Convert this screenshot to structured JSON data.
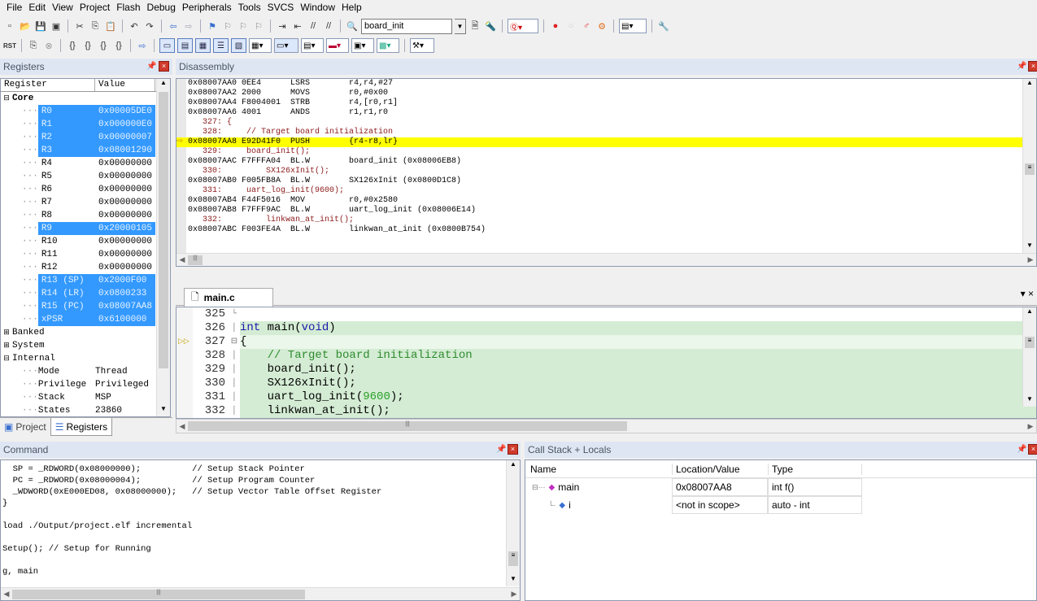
{
  "menu": [
    "File",
    "Edit",
    "View",
    "Project",
    "Flash",
    "Debug",
    "Peripherals",
    "Tools",
    "SVCS",
    "Window",
    "Help"
  ],
  "toolbar": {
    "target_combo": "board_init",
    "rst_label": "RST"
  },
  "registers_panel": {
    "title": "Registers",
    "col_register": "Register",
    "col_value": "Value",
    "groups": [
      {
        "name": "Core",
        "sign": "⊟"
      }
    ],
    "rows": [
      {
        "name": "R0",
        "value": "0x00005DE0",
        "selected": true
      },
      {
        "name": "R1",
        "value": "0x000000E0",
        "selected": true
      },
      {
        "name": "R2",
        "value": "0x00000007",
        "selected": true
      },
      {
        "name": "R3",
        "value": "0x08001290",
        "selected": true
      },
      {
        "name": "R4",
        "value": "0x00000000",
        "selected": false
      },
      {
        "name": "R5",
        "value": "0x00000000",
        "selected": false
      },
      {
        "name": "R6",
        "value": "0x00000000",
        "selected": false
      },
      {
        "name": "R7",
        "value": "0x00000000",
        "selected": false
      },
      {
        "name": "R8",
        "value": "0x00000000",
        "selected": false
      },
      {
        "name": "R9",
        "value": "0x20000105",
        "selected": true
      },
      {
        "name": "R10",
        "value": "0x00000000",
        "selected": false
      },
      {
        "name": "R11",
        "value": "0x00000000",
        "selected": false
      },
      {
        "name": "R12",
        "value": "0x00000000",
        "selected": false
      },
      {
        "name": "R13 (SP)",
        "value": "0x2000F00",
        "selected": true
      },
      {
        "name": "R14 (LR)",
        "value": "0x0800233",
        "selected": true
      },
      {
        "name": "R15 (PC)",
        "value": "0x08007AA8",
        "selected": true
      },
      {
        "name": "xPSR",
        "value": "0x6100000",
        "selected": true
      }
    ],
    "other_groups": [
      "Banked",
      "System",
      "Internal"
    ],
    "internal_rows": [
      {
        "name": "Mode",
        "value": "Thread"
      },
      {
        "name": "Privilege",
        "value": "Privileged"
      },
      {
        "name": "Stack",
        "value": "MSP"
      },
      {
        "name": "States",
        "value": "23860"
      }
    ],
    "tabs": {
      "project": "Project",
      "registers": "Registers"
    }
  },
  "disassembly": {
    "title": "Disassembly",
    "lines": [
      {
        "text": "0x08007AA0 0EE4      LSRS        r4,r4,#27",
        "type": "asm"
      },
      {
        "text": "0x08007AA2 2000      MOVS        r0,#0x00",
        "type": "asm"
      },
      {
        "text": "0x08007AA4 F8004001  STRB        r4,[r0,r1]",
        "type": "asm"
      },
      {
        "text": "0x08007AA6 4001      ANDS        r1,r1,r0",
        "type": "asm"
      },
      {
        "text": "   327: {",
        "type": "src"
      },
      {
        "text": "   328:     // Target board initialization",
        "type": "src"
      },
      {
        "text": "0x08007AA8 E92D41F0  PUSH        {r4-r8,lr}",
        "type": "cur"
      },
      {
        "text": "   329:     board_init();",
        "type": "src"
      },
      {
        "text": "0x08007AAC F7FFFA04  BL.W        board_init (0x08006EB8)",
        "type": "asm"
      },
      {
        "text": "   330:         SX126xInit();",
        "type": "src"
      },
      {
        "text": "0x08007AB0 F005FB8A  BL.W        SX126xInit (0x0800D1C8)",
        "type": "asm"
      },
      {
        "text": "   331:     uart_log_init(9600);",
        "type": "src"
      },
      {
        "text": "0x08007AB4 F44F5016  MOV         r0,#0x2580",
        "type": "asm"
      },
      {
        "text": "0x08007AB8 F7FFF9AC  BL.W        uart_log_init (0x08006E14)",
        "type": "asm"
      },
      {
        "text": "   332:         linkwan_at_init();",
        "type": "src"
      },
      {
        "text": "0x08007ABC F003FE4A  BL.W        linkwan_at_init (0x0800B754)",
        "type": "asm"
      }
    ]
  },
  "editor": {
    "tab": "main.c",
    "lines": [
      {
        "num": "325",
        "code": ""
      },
      {
        "num": "326",
        "code": "int main(void)"
      },
      {
        "num": "327",
        "code": "{"
      },
      {
        "num": "328",
        "code": "    // Target board initialization"
      },
      {
        "num": "329",
        "code": "    board_init();"
      },
      {
        "num": "330",
        "code": "    SX126xInit();"
      },
      {
        "num": "331",
        "code": "    uart_log_init(9600);"
      },
      {
        "num": "332",
        "code": "    linkwan_at_init();"
      }
    ]
  },
  "command": {
    "title": "Command",
    "lines": [
      "  SP = _RDWORD(0x08000000);          // Setup Stack Pointer",
      "  PC = _RDWORD(0x08000004);          // Setup Program Counter",
      "  _WDWORD(0xE000ED08, 0x08000000);   // Setup Vector Table Offset Register",
      "}",
      "",
      "load ./Output/project.elf incremental",
      "",
      "Setup(); // Setup for Running",
      "",
      "g, main"
    ]
  },
  "callstack": {
    "title": "Call Stack + Locals",
    "col_name": "Name",
    "col_location": "Location/Value",
    "col_type": "Type",
    "rows": [
      {
        "name": "main",
        "location": "0x08007AA8",
        "type": "int f()"
      },
      {
        "name": "i",
        "location": "<not in scope>",
        "type": "auto - int"
      }
    ]
  },
  "colors": {
    "selection": "#3399ff",
    "current_line": "#ffff00",
    "editor_bg": "#d4ecd4"
  }
}
